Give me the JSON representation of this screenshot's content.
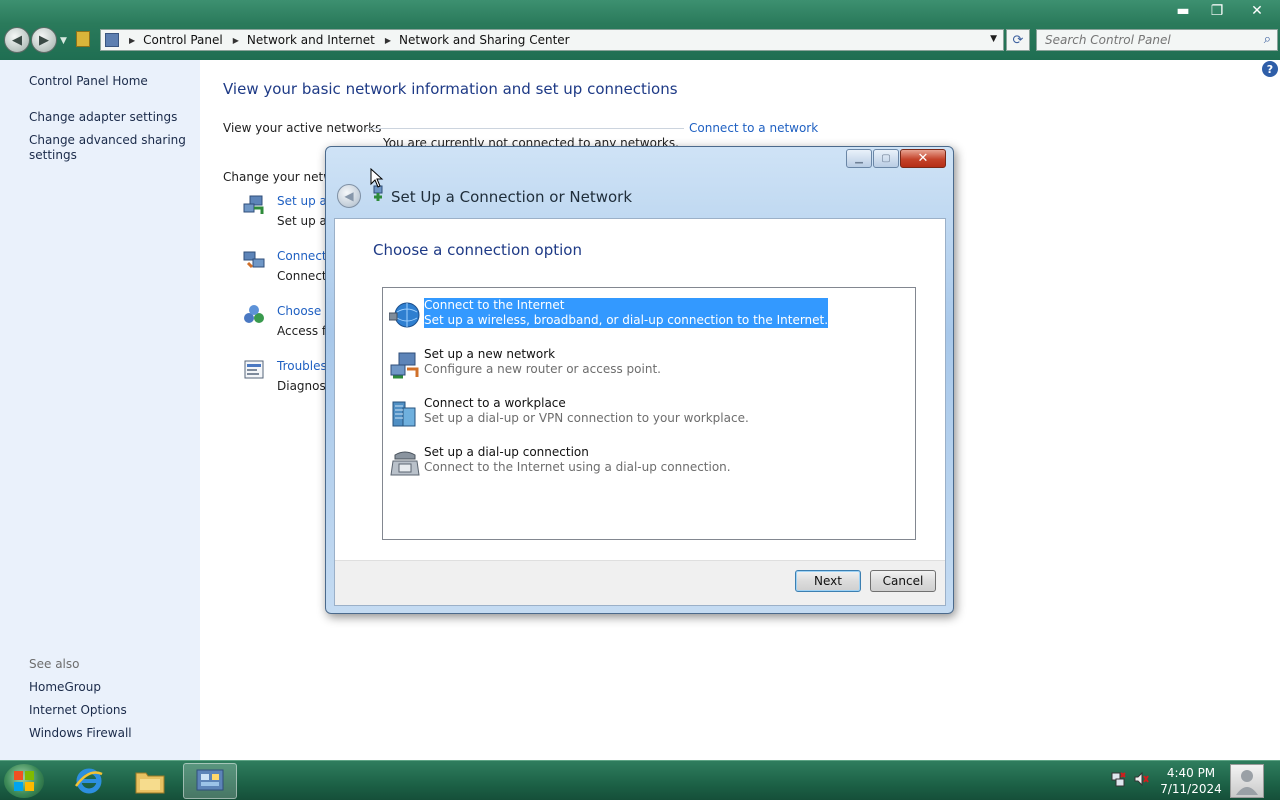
{
  "explorer": {
    "breadcrumb": [
      "Control Panel",
      "Network and Internet",
      "Network and Sharing Center"
    ],
    "search_placeholder": "Search Control Panel",
    "window_buttons": {
      "minimize": "▬",
      "maximize": "❐",
      "close": "✕"
    }
  },
  "sidebar": {
    "home": "Control Panel Home",
    "items": [
      "Change adapter settings",
      "Change advanced sharing settings"
    ],
    "see_also_label": "See also",
    "see_also": [
      "HomeGroup",
      "Internet Options",
      "Windows Firewall"
    ]
  },
  "main": {
    "title": "View your basic network information and set up connections",
    "active_networks_label": "View your active networks",
    "connect_link": "Connect to a network",
    "not_connected": "You are currently not connected to any networks.",
    "change_label": "Change your netwo",
    "tasks": [
      {
        "link": "Set up a n",
        "desc": "Set up a w"
      },
      {
        "link": "Connect t",
        "desc": "Connect b"
      },
      {
        "link": "Choose h",
        "desc": "Access file"
      },
      {
        "link": "Troublesh",
        "desc": "Diagnose a"
      }
    ]
  },
  "dialog": {
    "title": "Set Up a Connection or Network",
    "heading": "Choose a connection option",
    "options": [
      {
        "title": "Connect to the Internet",
        "desc": "Set up a wireless, broadband, or dial-up connection to the Internet.",
        "icon": "globe-icon",
        "selected": true
      },
      {
        "title": "Set up a new network",
        "desc": "Configure a new router or access point.",
        "icon": "network-icon",
        "selected": false
      },
      {
        "title": "Connect to a workplace",
        "desc": "Set up a dial-up or VPN connection to your workplace.",
        "icon": "workplace-icon",
        "selected": false
      },
      {
        "title": "Set up a dial-up connection",
        "desc": "Connect to the Internet using a dial-up connection.",
        "icon": "phone-icon",
        "selected": false
      }
    ],
    "next": "Next",
    "cancel": "Cancel"
  },
  "taskbar": {
    "time": "4:40 PM",
    "date": "7/11/2024"
  }
}
